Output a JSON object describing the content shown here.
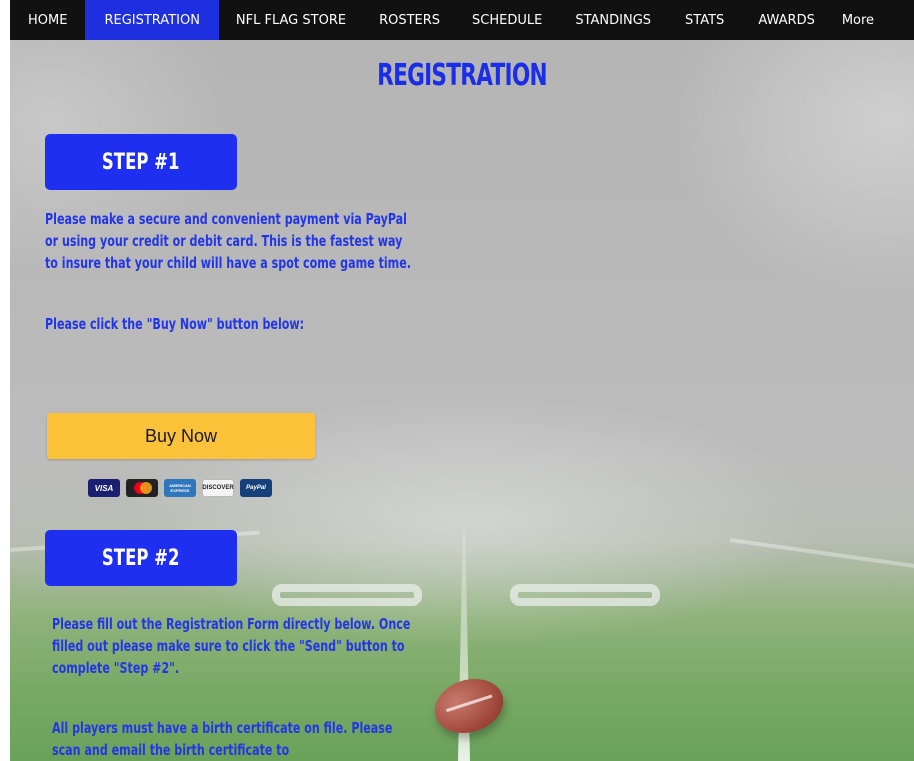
{
  "nav": {
    "items": [
      {
        "label": "HOME",
        "active": false
      },
      {
        "label": "REGISTRATION",
        "active": true
      },
      {
        "label": "NFL FLAG STORE",
        "active": false
      },
      {
        "label": "ROSTERS",
        "active": false
      },
      {
        "label": "SCHEDULE",
        "active": false
      },
      {
        "label": "STANDINGS",
        "active": false
      },
      {
        "label": "STATS",
        "active": false
      },
      {
        "label": "AWARDS",
        "active": false
      },
      {
        "label": "More",
        "active": false
      }
    ]
  },
  "page": {
    "title": "REGISTRATION"
  },
  "step1": {
    "label": "STEP #1",
    "paragraph_lines": [
      "Please make a secure and convenient payment via PayPal",
      "or using your credit or debit card. This is the fastest way",
      "to insure that your child will have a spot come game time."
    ],
    "instruction": "Please click the \"Buy Now\" button below:",
    "buy_button": "Buy Now",
    "payment_cards": [
      "VISA",
      "mastercard",
      "AMERICAN EXPRESS",
      "DISCOVER",
      "PayPal"
    ]
  },
  "step2": {
    "label": "STEP #2",
    "paragraph_lines": [
      "Please fill out the Registration Form directly below. Once",
      "filled out please make sure to click the \"Send\" button to",
      "complete \"Step #2\"."
    ],
    "note_lines": [
      "All players must have a birth certificate on file. Please",
      "scan and email the birth certificate to"
    ]
  },
  "colors": {
    "nav_bg": "#111111",
    "nav_active": "#1e2fe0",
    "accent_blue": "#1e2ff0",
    "buy_button": "#fbc23a"
  }
}
